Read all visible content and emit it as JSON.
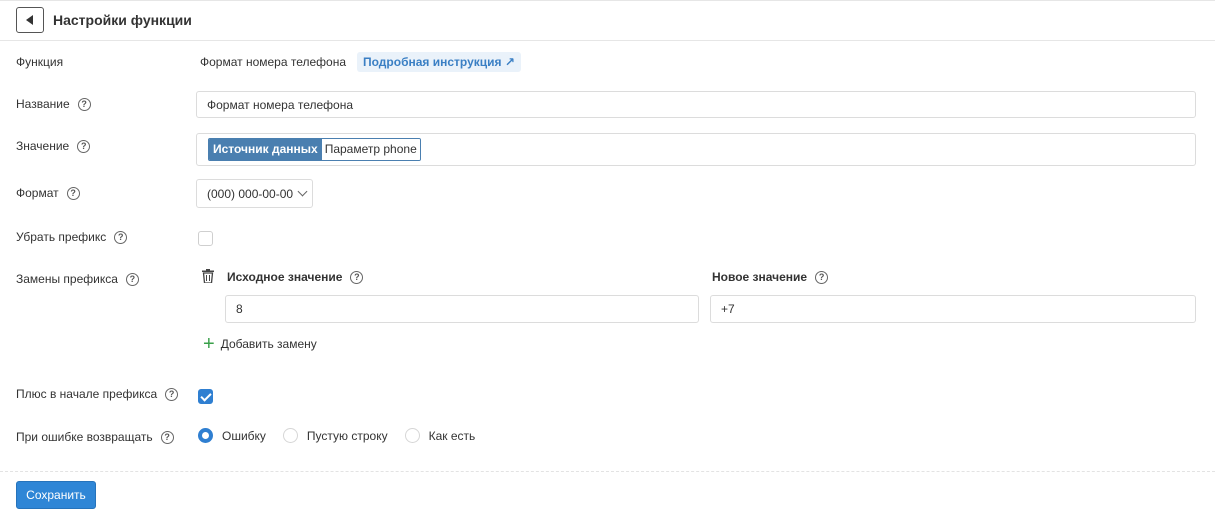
{
  "header": {
    "title": "Настройки функции"
  },
  "function": {
    "label": "Функция",
    "value": "Формат номера телефона",
    "instruction_link": "Подробная инструкция ↗"
  },
  "name": {
    "label": "Название",
    "value": "Формат номера телефона"
  },
  "value": {
    "label": "Значение",
    "tag_source": "Источник данных",
    "tag_param": "Параметр phone"
  },
  "format": {
    "label": "Формат",
    "selected": "(000) 000-00-00"
  },
  "remove_prefix": {
    "label": "Убрать префикс",
    "checked": false
  },
  "prefix_replacements": {
    "label": "Замены префикса",
    "col_source": "Исходное значение",
    "col_new": "Новое значение",
    "rows": [
      {
        "source": "8",
        "new": "+7"
      }
    ],
    "add_label": "Добавить замену"
  },
  "plus_prefix": {
    "label": "Плюс в начале префикса",
    "checked": true
  },
  "on_error": {
    "label": "При ошибке возвращать",
    "options": [
      "Ошибку",
      "Пустую строку",
      "Как есть"
    ],
    "selected": "Ошибку"
  },
  "footer": {
    "save_label": "Сохранить"
  },
  "colors": {
    "accent": "#2f86d6",
    "tag": "#4a7fb0",
    "add": "#3aa04a",
    "link": "#3a7fc4"
  }
}
